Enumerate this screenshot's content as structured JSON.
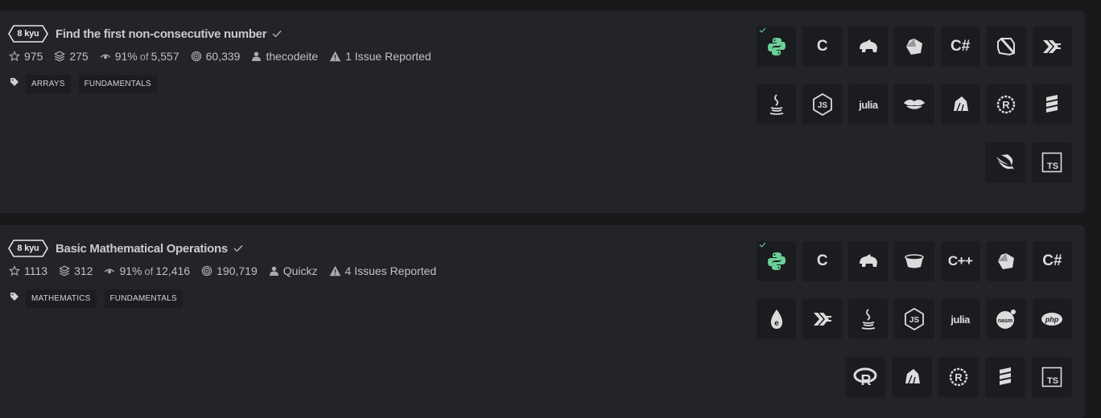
{
  "kata": [
    {
      "rank": "8 kyu",
      "title": "Find the first non-consecutive number",
      "stars": "975",
      "collections": "275",
      "satisfaction": "91%",
      "of_label": "of",
      "votes": "5,557",
      "completions": "60,339",
      "author": "thecodeite",
      "issues": "1 Issue Reported",
      "tags": [
        "ARRAYS",
        "FUNDAMENTALS"
      ],
      "languages": [
        [
          "python",
          "c",
          "coffeescript",
          "crystal",
          "csharp",
          "dart",
          "elixir"
        ],
        [
          "java",
          "javascript",
          "julia",
          "lua",
          "nim",
          "racket",
          "scala"
        ],
        [
          "swift",
          "typescript"
        ]
      ]
    },
    {
      "rank": "8 kyu",
      "title": "Basic Mathematical Operations",
      "stars": "1113",
      "collections": "312",
      "satisfaction": "91%",
      "of_label": "of",
      "votes": "12,416",
      "completions": "190,719",
      "author": "Quickz",
      "issues": "4 Issues Reported",
      "tags": [
        "MATHEMATICS",
        "FUNDAMENTALS"
      ],
      "languages": [
        [
          "python",
          "c",
          "coffeescript",
          "cobol",
          "cpp",
          "crystal",
          "csharp"
        ],
        [
          "elixir",
          "haskell",
          "java",
          "javascript",
          "julia",
          "nasm",
          "php"
        ],
        [
          "r",
          "nim",
          "racket",
          "scala",
          "typescript"
        ]
      ]
    }
  ],
  "lang_labels": {
    "c": "C",
    "csharp": "C#",
    "cpp": "C++",
    "julia": "julia",
    "typescript": "TS",
    "nasm": "nasm",
    "php": "php",
    "javascript": "JS",
    "r": "R"
  },
  "colors": {
    "page_bg": "#18191b",
    "card_bg": "#232427",
    "tag_bg": "#1c1d20",
    "solved_green": "#6ccf97"
  }
}
